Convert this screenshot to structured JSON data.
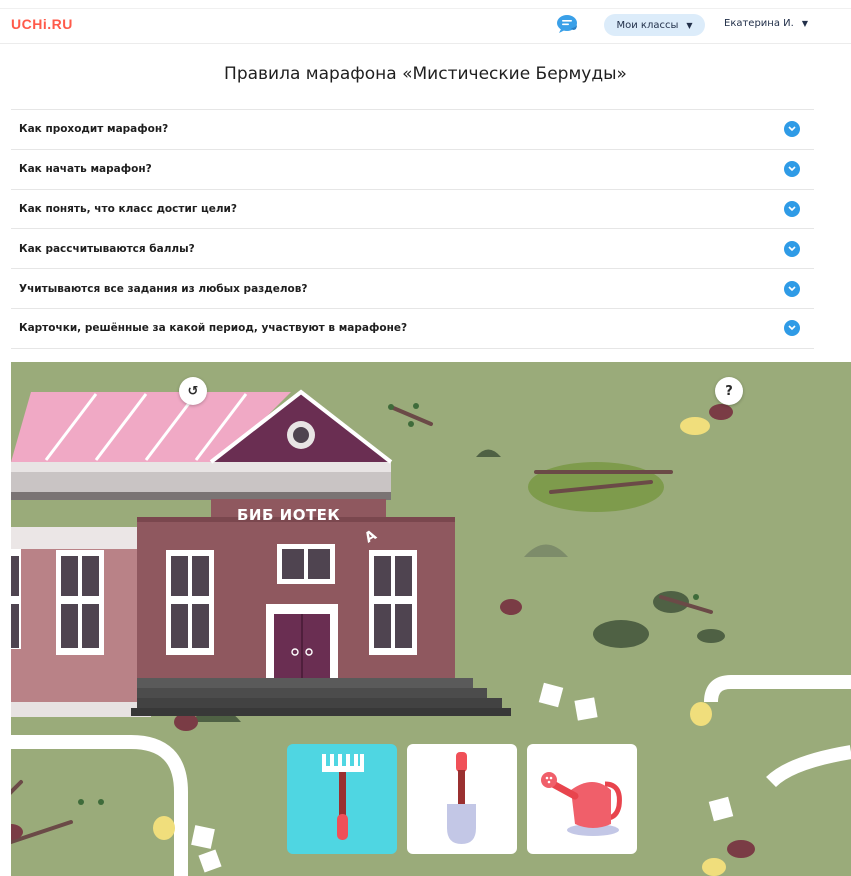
{
  "header": {
    "logo": "UCHi.RU",
    "classes_label": "Мои классы",
    "user_name": "Екатерина И."
  },
  "page": {
    "title": "Правила марафона «Мистические Бермуды»"
  },
  "faq": [
    {
      "question": "Как проходит марафон?"
    },
    {
      "question": "Как начать марафон?"
    },
    {
      "question": "Как понять, что класс достиг цели?"
    },
    {
      "question": "Как рассчитываются баллы?"
    },
    {
      "question": "Учитываются все задания из любых разделов?"
    },
    {
      "question": "Карточки, решённые за какой период, участвуют в марафоне?"
    }
  ],
  "game": {
    "back_label": "↺",
    "help_label": "?",
    "library_sign": "БИБ  ИОТЕК",
    "tools": [
      {
        "name": "rake",
        "selected": true
      },
      {
        "name": "shovel",
        "selected": false
      },
      {
        "name": "watering-can",
        "selected": false
      }
    ]
  },
  "colors": {
    "accent": "#2f9be6",
    "logo": "#ff5a4a",
    "grass": "#9aab7a",
    "selected_card": "#4fd6e2"
  }
}
